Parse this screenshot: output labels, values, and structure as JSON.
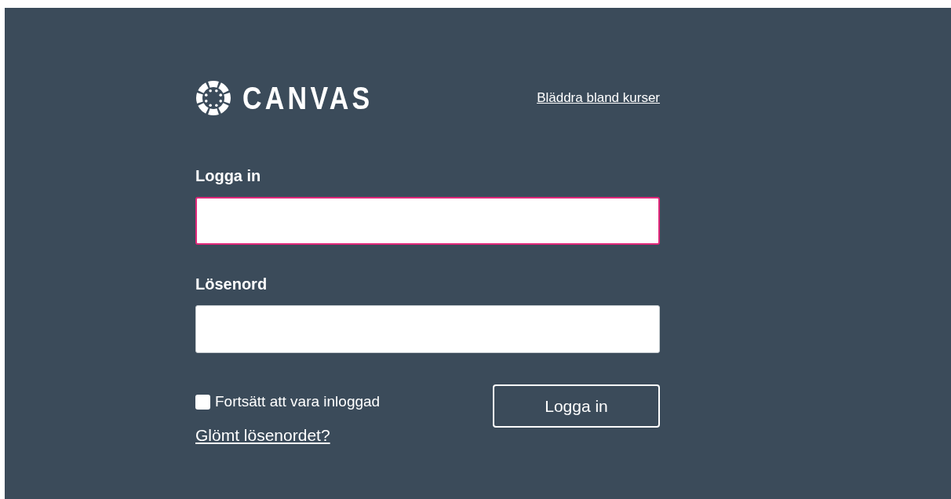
{
  "logo": {
    "text": "CANVAS"
  },
  "browse_link": "Bläddra bland kurser",
  "fields": [
    {
      "label": "Logga in",
      "focused": true
    },
    {
      "label": "Lösenord",
      "focused": false
    }
  ],
  "remember": {
    "label": "Fortsätt att vara inloggad",
    "checked": false
  },
  "forgot_link": "Glömt lösenordet?",
  "submit_button": "Logga in"
}
